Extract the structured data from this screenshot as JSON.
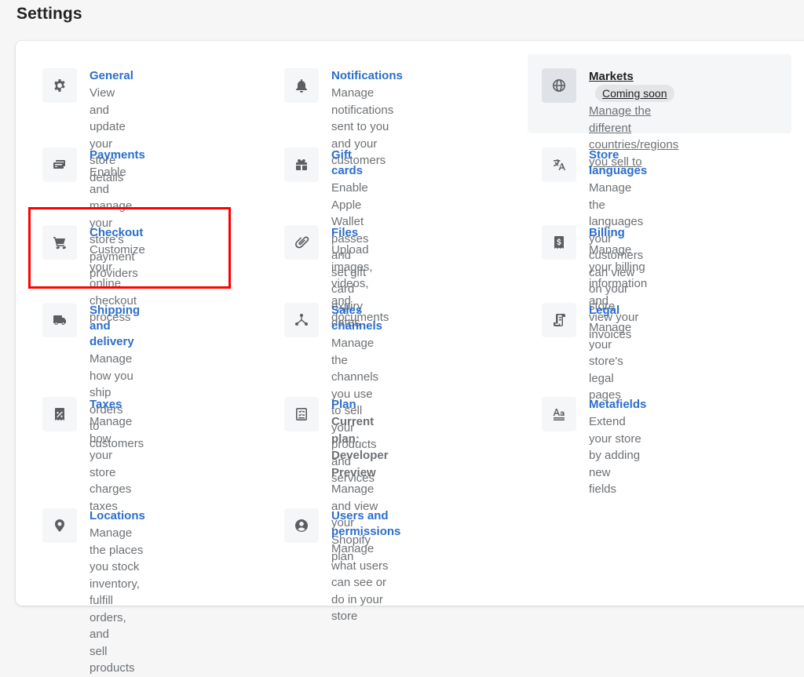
{
  "page": {
    "title": "Settings"
  },
  "items": {
    "general": {
      "title": "General",
      "desc": [
        "View and update your store",
        "details"
      ],
      "icon": "gear-icon"
    },
    "notifications": {
      "title": "Notifications",
      "desc": [
        "Manage notifications sent to you",
        "and your customers"
      ],
      "icon": "bell-icon"
    },
    "markets": {
      "title": "Markets",
      "badge": "Coming soon",
      "desc": [
        "Manage the different",
        "countries/regions you sell to"
      ],
      "icon": "globe-icon"
    },
    "payments": {
      "title": "Payments",
      "desc": [
        "Enable and manage your",
        "store's payment providers"
      ],
      "icon": "payments-icon"
    },
    "gift_cards": {
      "title": "Gift cards",
      "desc": [
        "Enable Apple Wallet passes and",
        "set gift card expiry dates"
      ],
      "icon": "gift-icon"
    },
    "store_languages": {
      "title": "Store languages",
      "desc": [
        "Manage the languages your",
        "customers can view on your store"
      ],
      "icon": "translate-icon"
    },
    "checkout": {
      "title": "Checkout",
      "desc": [
        "Customize your online",
        "checkout process"
      ],
      "icon": "cart-icon"
    },
    "files": {
      "title": "Files",
      "desc": [
        "Upload images, videos, and",
        "documents"
      ],
      "icon": "paperclip-icon"
    },
    "billing": {
      "title": "Billing",
      "desc": [
        "Manage your billing information and",
        "view your invoices"
      ],
      "icon": "billing-icon"
    },
    "shipping": {
      "title": "Shipping and delivery",
      "desc": [
        "Manage how you ship orders",
        "to customers"
      ],
      "icon": "truck-icon"
    },
    "sales_channels": {
      "title": "Sales channels",
      "desc": [
        "Manage the channels you use",
        "to sell your products and",
        "services"
      ],
      "icon": "channels-icon"
    },
    "legal": {
      "title": "Legal",
      "desc": [
        "Manage your store's legal pages"
      ],
      "icon": "legal-icon"
    },
    "taxes": {
      "title": "Taxes",
      "desc": [
        "Manage how your store",
        "charges taxes"
      ],
      "icon": "tax-icon"
    },
    "plan": {
      "title": "Plan",
      "sub": [
        "Current plan: Developer",
        "Preview"
      ],
      "desc": [
        "Manage and view your Shopify",
        "plan"
      ],
      "icon": "plan-icon"
    },
    "metafields": {
      "title": "Metafields",
      "desc": [
        "Extend your store by adding new",
        "fields"
      ],
      "icon": "metafields-icon"
    },
    "locations": {
      "title": "Locations",
      "desc": [
        "Manage the places you stock",
        "inventory, fulfill orders, and",
        "sell products"
      ],
      "icon": "location-icon"
    },
    "users": {
      "title": "Users and permissions",
      "desc": [
        "Manage what users can see or",
        "do in your store"
      ],
      "icon": "user-icon"
    }
  },
  "colors": {
    "link": "#2c6ecb",
    "muted": "#6d7175",
    "highlight": "#ff0000"
  }
}
